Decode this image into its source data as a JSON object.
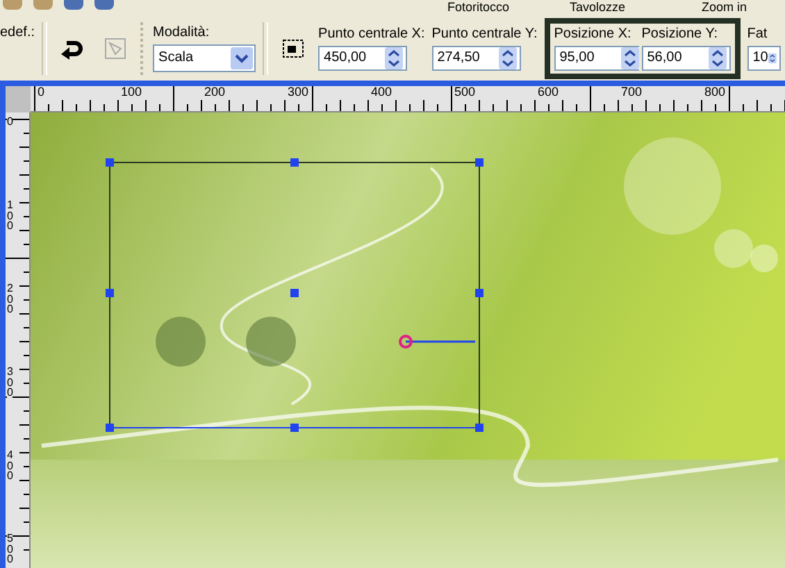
{
  "menu_strip": [
    {
      "label": "Fotoritocco"
    },
    {
      "label": "Tavolozze"
    },
    {
      "label": "Zoom in"
    }
  ],
  "tool_options": {
    "preset_label": "edef.:",
    "mode": {
      "label": "Modalità:",
      "value": "Scala"
    },
    "fields": [
      {
        "label": "Punto centrale X:",
        "value": "450,00",
        "highlighted": false
      },
      {
        "label": "Punto centrale Y:",
        "value": "274,50",
        "highlighted": false
      },
      {
        "label": "Posizione X:",
        "value": "95,00",
        "highlighted": true
      },
      {
        "label": "Posizione Y:",
        "value": "56,00",
        "highlighted": true
      },
      {
        "label": "Fat",
        "value": "10",
        "highlighted": false
      }
    ]
  },
  "rulers": {
    "horizontal": [
      "0",
      "100",
      "200",
      "300",
      "400",
      "500",
      "600",
      "700",
      "800"
    ],
    "vertical": [
      "0",
      "100",
      "200",
      "300",
      "400",
      "500"
    ]
  }
}
